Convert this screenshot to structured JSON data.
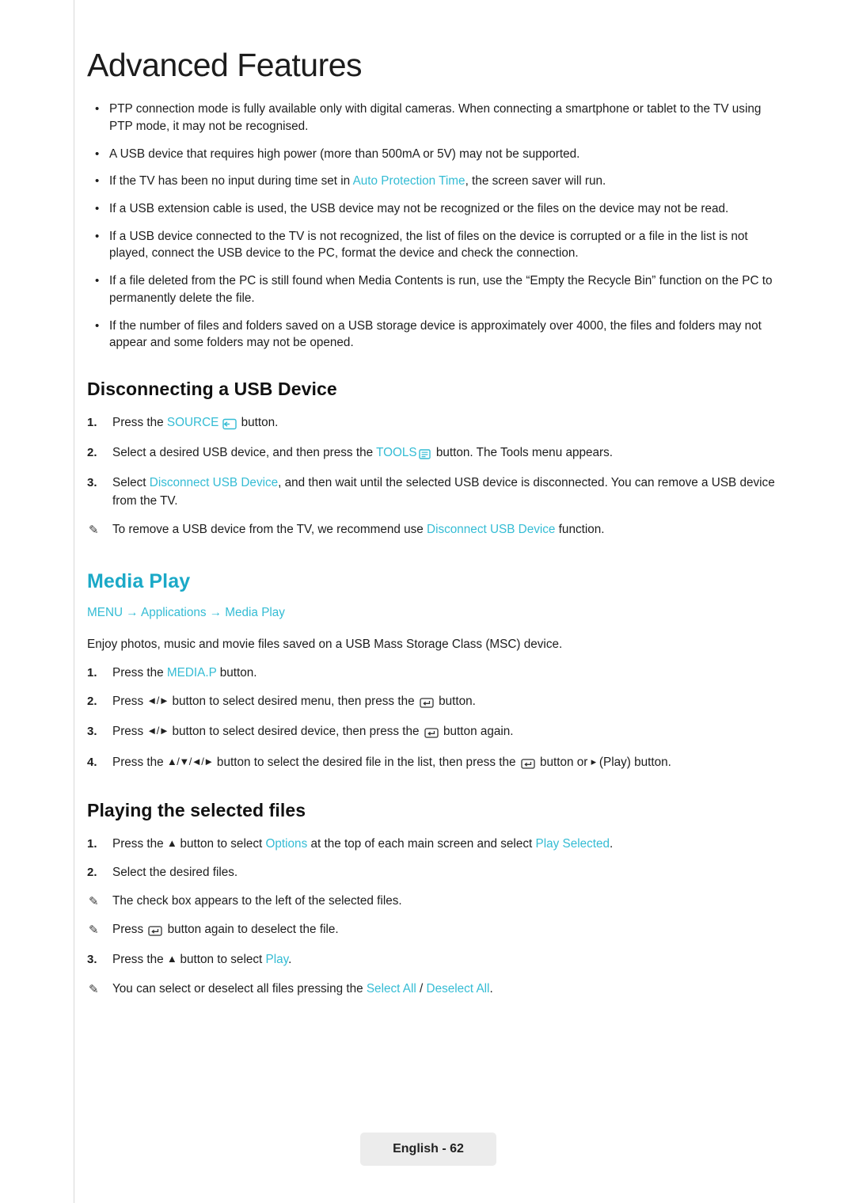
{
  "page": {
    "title": "Advanced Features",
    "footer_label": "English - 62",
    "accent": "#34bcd4",
    "heading_accent": "#1ba9c7"
  },
  "bullets": [
    "PTP connection mode is fully available only with digital cameras. When connecting a smartphone or tablet to the TV using PTP mode, it may not be recognised.",
    "A USB device that requires high power (more than 500mA or 5V) may not be supported.",
    "If a USB extension cable is used, the USB device may not be recognized or the files on the device may not be read.",
    "If a USB device connected to the TV is not recognized, the list of files on the device is corrupted or a file in the list is not played, connect the USB device to the PC, format the device and check the connection.",
    "If a file deleted from the PC is still found when Media Contents is run, use the “Empty the Recycle Bin” function on the PC to permanently delete the file.",
    "If the number of files and folders saved on a USB storage device is approximately over 4000, the files and folders may not appear and some folders may not be opened."
  ],
  "bullet_auto_protection": {
    "before": "If the TV has been no input during time set in ",
    "link": "Auto Protection Time",
    "after": ", the screen saver will run."
  },
  "sections": {
    "disconnecting": {
      "heading": "Disconnecting a USB Device",
      "step1": {
        "num": "1.",
        "before": "Press the ",
        "link": "SOURCE",
        "after": " button."
      },
      "step2": {
        "num": "2.",
        "before": "Select a desired USB device, and then press the ",
        "link": "TOOLS",
        "after": " button. The Tools menu appears."
      },
      "step3": {
        "num": "3.",
        "before": "Select ",
        "link": "Disconnect USB Device",
        "after": ", and then wait until the selected USB device is disconnected. You can remove a USB device from the TV."
      },
      "note": {
        "before": "To remove a USB device from the TV, we recommend use ",
        "link": "Disconnect USB Device",
        "after": " function."
      }
    },
    "media_play": {
      "heading": "Media Play",
      "menu_path": {
        "root": "MENU",
        "arrow": "→",
        "item1": "Applications",
        "item2": "Media Play"
      },
      "intro": "Enjoy photos, music and movie files saved on a USB Mass Storage Class (MSC) device.",
      "step1": {
        "num": "1.",
        "before": "Press the ",
        "link": "MEDIA.P",
        "after": " button."
      },
      "step2": {
        "num": "2.",
        "before": "Press ",
        "keys": "◄/►",
        "mid": " button to select desired menu, then press the ",
        "after": " button."
      },
      "step3": {
        "num": "3.",
        "before": "Press ",
        "keys": "◄/►",
        "mid": " button to select desired device, then press the ",
        "after": " button again."
      },
      "step4": {
        "num": "4.",
        "before": "Press the ",
        "keys": "▲/▼/◄/►",
        "mid": " button to select the desired file in the list, then press the ",
        "after": " button or ",
        "tail": " (Play) button."
      }
    },
    "playing_selected": {
      "heading": "Playing the selected files",
      "step1": {
        "num": "1.",
        "before": "Press the ",
        "mid": " button to select ",
        "link1": "Options",
        "mid2": " at the top of each main screen and select ",
        "link2": "Play Selected",
        "after": "."
      },
      "step2": {
        "num": "2.",
        "text": "Select the desired files."
      },
      "note1": "The check box appears to the left of the selected files.",
      "note2": {
        "before": "Press ",
        "after": " button again to deselect the file."
      },
      "step3": {
        "num": "3.",
        "before": "Press the ",
        "mid": " button to select ",
        "link": "Play",
        "after": "."
      },
      "note3": {
        "before": "You can select or deselect all files pressing the ",
        "link1": "Select All",
        "sep": " / ",
        "link2": "Deselect All",
        "after": "."
      }
    }
  },
  "icons": {
    "bullet": "•",
    "pen": "✎",
    "enter": "enter-key-icon",
    "source": "source-key-icon",
    "tools": "tools-key-icon",
    "play": "▸",
    "up": "▲"
  }
}
